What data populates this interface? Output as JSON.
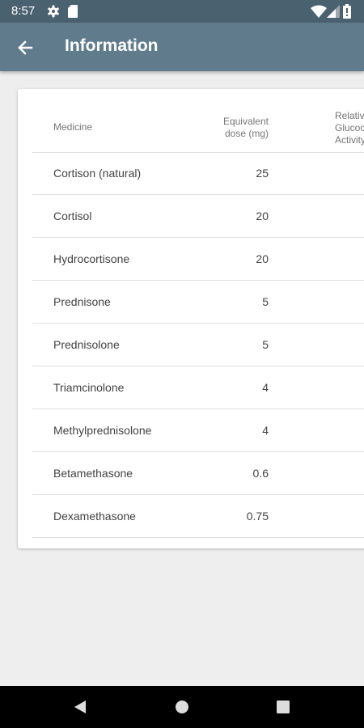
{
  "status_bar": {
    "time": "8:57",
    "icons": [
      "gear-icon",
      "sd-card-icon",
      "wifi-icon",
      "signal-icon",
      "battery-icon"
    ]
  },
  "app_bar": {
    "title": "Information",
    "back_icon": "arrow-left-icon"
  },
  "table": {
    "headers": {
      "medicine": "Medicine",
      "dose_line1": "Equivalent",
      "dose_line2": "dose (mg)",
      "relative_line1": "Relative",
      "relative_line2": "Glucocorticoid",
      "relative_line3": "Activity"
    },
    "rows": [
      {
        "medicine": "Cortison (natural)",
        "dose": "25"
      },
      {
        "medicine": "Cortisol",
        "dose": "20"
      },
      {
        "medicine": "Hydrocortisone",
        "dose": "20"
      },
      {
        "medicine": "Prednisone",
        "dose": "5"
      },
      {
        "medicine": "Prednisolone",
        "dose": "5"
      },
      {
        "medicine": "Triamcinolone",
        "dose": "4"
      },
      {
        "medicine": "Methylprednisolone",
        "dose": "4"
      },
      {
        "medicine": "Betamethasone",
        "dose": "0.6"
      },
      {
        "medicine": "Dexamethasone",
        "dose": "0.75"
      }
    ]
  },
  "nav_bar": {
    "icons": [
      "nav-back-icon",
      "nav-home-icon",
      "nav-recents-icon"
    ]
  },
  "colors": {
    "status_bar": "#4a6170",
    "app_bar": "#5f7b8c",
    "background": "#eeeeee"
  }
}
